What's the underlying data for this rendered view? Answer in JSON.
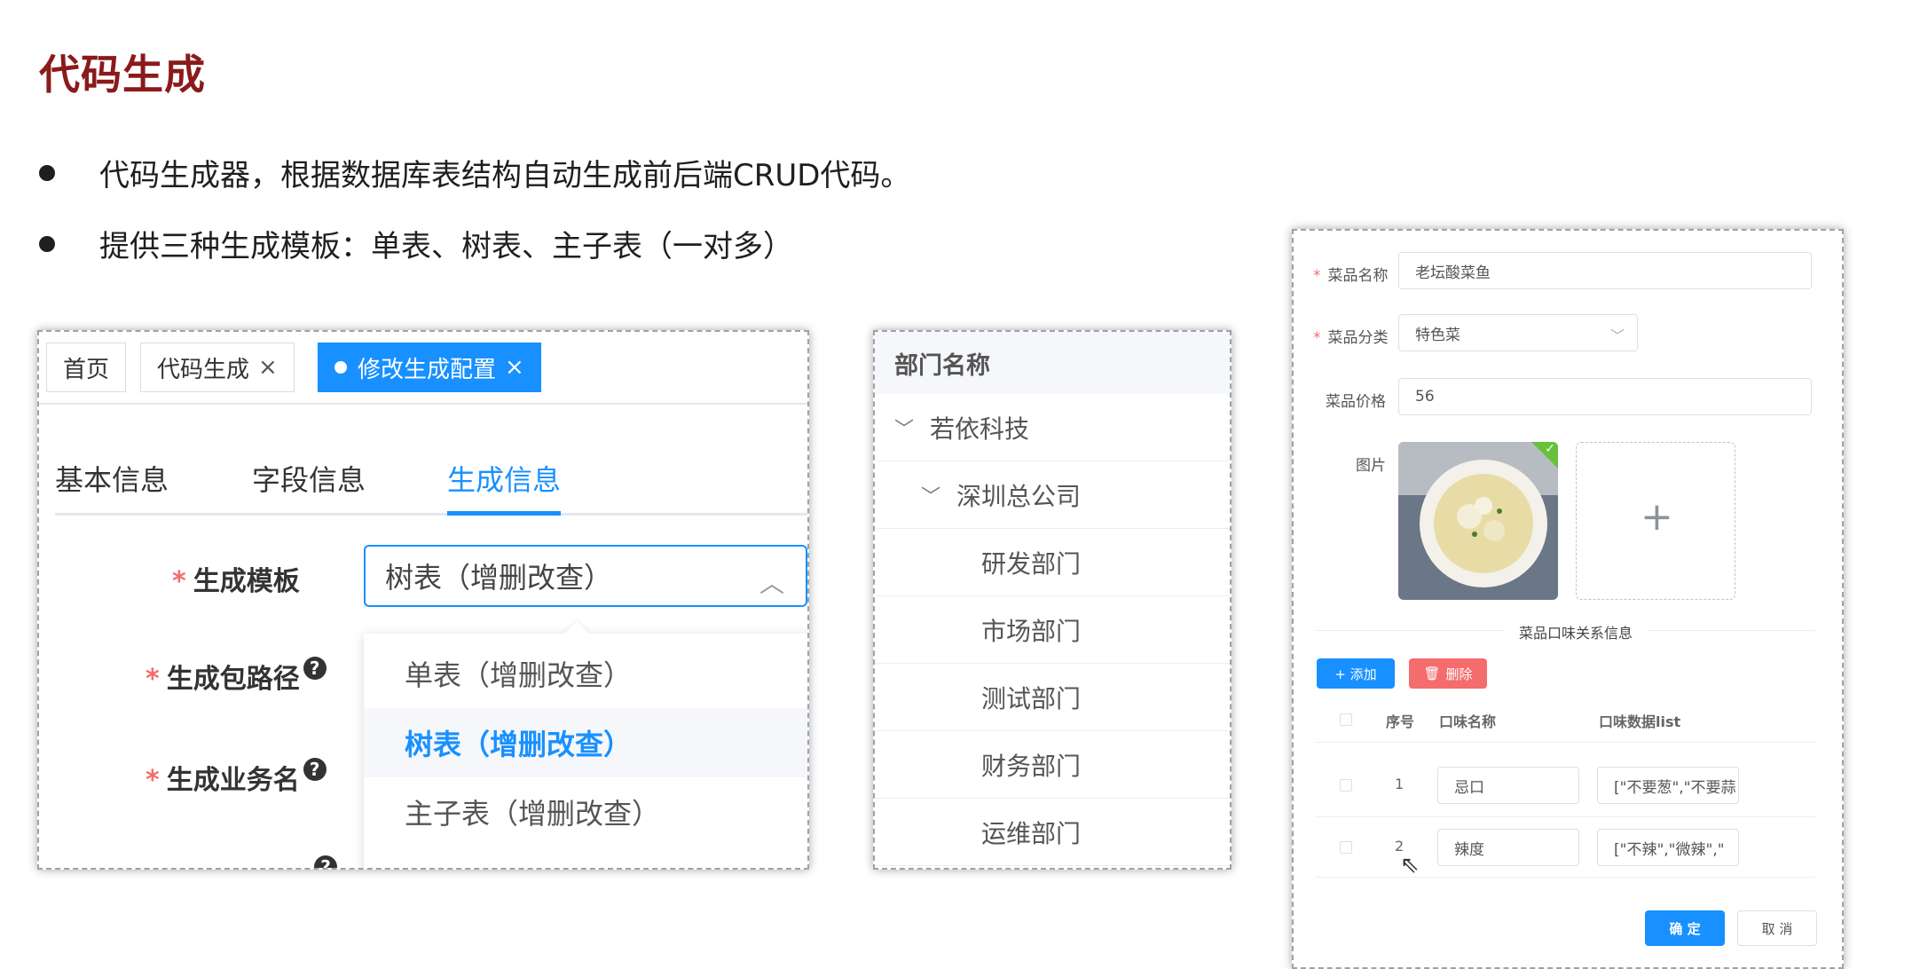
{
  "slide": {
    "title": "代码生成",
    "bullets": [
      "代码生成器，根据数据库表结构自动生成前后端CRUD代码。",
      "提供三种生成模板：单表、树表、主子表（一对多）"
    ]
  },
  "panel1": {
    "tags": [
      "首页",
      "代码生成",
      "修改生成配置"
    ],
    "tag_close": "×",
    "subtabs": [
      "基本信息",
      "字段信息",
      "生成信息"
    ],
    "fields": [
      "生成模板",
      "生成包路径",
      "生成业务名"
    ],
    "required_mark": "*",
    "help_mark": "?",
    "select_value": "树表（增删改查）",
    "options": [
      "单表（增删改查）",
      "树表（增删改查）",
      "主子表（增删改查）"
    ]
  },
  "panel2": {
    "header": "部门名称",
    "tree": [
      {
        "label": "若依科技",
        "level": 0,
        "expanded": true
      },
      {
        "label": "深圳总公司",
        "level": 1,
        "expanded": true
      },
      {
        "label": "研发部门",
        "level": 2
      },
      {
        "label": "市场部门",
        "level": 2
      },
      {
        "label": "测试部门",
        "level": 2
      },
      {
        "label": "财务部门",
        "level": 2
      },
      {
        "label": "运维部门",
        "level": 2
      }
    ]
  },
  "panel3": {
    "fields": {
      "name_label": "菜品名称",
      "name_value": "老坛酸菜鱼",
      "category_label": "菜品分类",
      "category_value": "特色菜",
      "price_label": "菜品价格",
      "price_value": "56",
      "image_label": "图片"
    },
    "upload_plus": "+",
    "section_title": "菜品口味关系信息",
    "add_button": "+ 添加",
    "delete_button": "删除",
    "table": {
      "headers": [
        "序号",
        "口味名称",
        "口味数据list"
      ],
      "rows": [
        {
          "index": "1",
          "name": "忌口",
          "data": "[\"不要葱\",\"不要蒜"
        },
        {
          "index": "2",
          "name": "辣度",
          "data": "[\"不辣\",\"微辣\",\""
        }
      ]
    },
    "confirm_button": "确 定",
    "cancel_button": "取 消"
  },
  "colors": {
    "primary": "#1890ff",
    "danger": "#f56c6c",
    "title": "#8b1a1a",
    "required": "#f56c6c"
  }
}
